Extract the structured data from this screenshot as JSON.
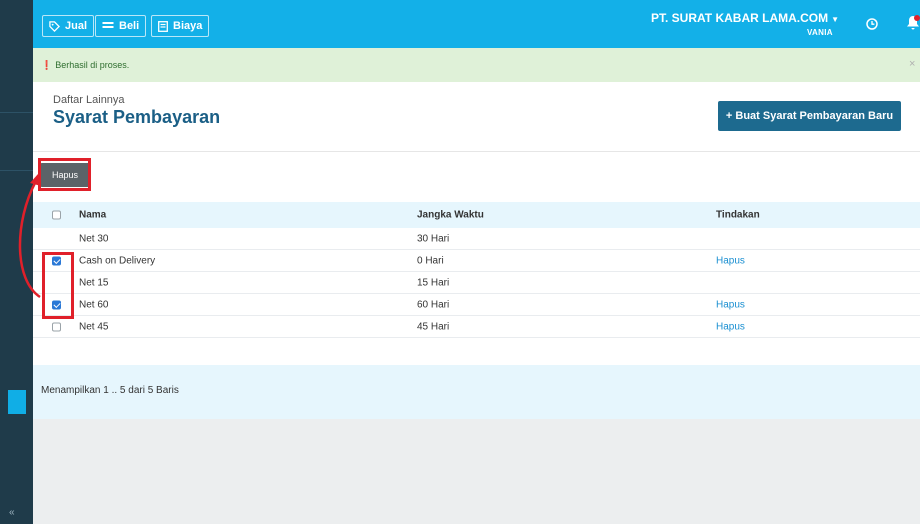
{
  "topbar": {
    "nav": [
      {
        "label": "Jual",
        "icon": "tag-icon"
      },
      {
        "label": "Beli",
        "icon": "card-icon"
      },
      {
        "label": "Biaya",
        "icon": "receipt-icon"
      }
    ],
    "company": "PT. SURAT KABAR LAMA.COM",
    "user": "VANIA",
    "brand_color": "#13b0e8"
  },
  "alert": {
    "message": "Berhasil di proses.",
    "info_icon": "❗",
    "close": "×"
  },
  "header": {
    "breadcrumb": "Daftar Lainnya",
    "title": "Syarat Pembayaran",
    "new_button": "+ Buat Syarat Pembayaran Baru"
  },
  "bulk_delete_label": "Hapus",
  "table": {
    "columns": [
      "Nama",
      "Jangka Waktu",
      "Tindakan"
    ],
    "rows": [
      {
        "nama": "Net 30",
        "jangka": "30 Hari",
        "action": "",
        "checked": false,
        "show_checkbox": false
      },
      {
        "nama": "Cash on Delivery",
        "jangka": "0 Hari",
        "action": "Hapus",
        "checked": true,
        "show_checkbox": true
      },
      {
        "nama": "Net 15",
        "jangka": "15 Hari",
        "action": "",
        "checked": false,
        "show_checkbox": false
      },
      {
        "nama": "Net 60",
        "jangka": "60 Hari",
        "action": "Hapus",
        "checked": true,
        "show_checkbox": true
      },
      {
        "nama": "Net 45",
        "jangka": "45 Hari",
        "action": "Hapus",
        "checked": false,
        "show_checkbox": true
      }
    ]
  },
  "pagination_info": "Menampilkan 1 .. 5 dari 5 Baris",
  "sidebar": {
    "collapse": "«"
  }
}
